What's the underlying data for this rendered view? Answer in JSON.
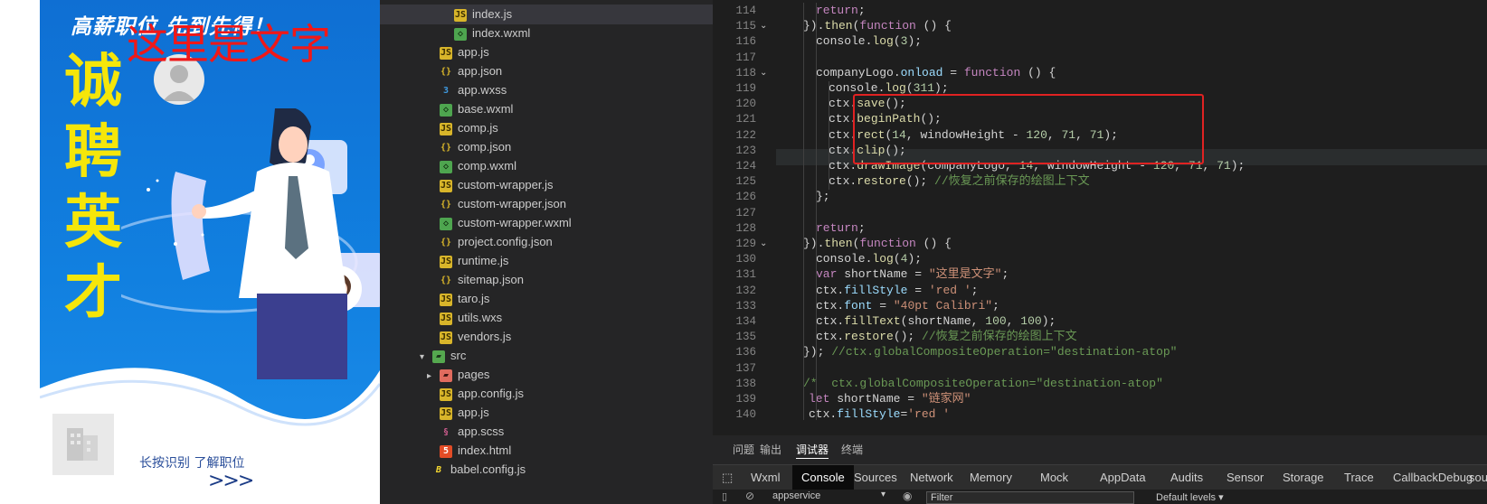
{
  "poster": {
    "headline": "高薪职位    先到先得！",
    "overlay_text": "这里是文字",
    "vertical_title": [
      "诚",
      "聘",
      "英",
      "才"
    ],
    "cta_text": "长按识别 了解职位",
    "cta_arrow": ">>>",
    "colors": {
      "background": "#0f78d8",
      "title": "#f5e60a",
      "overlay": "#f01818"
    }
  },
  "explorer": {
    "items": [
      {
        "label": "index.js",
        "icon": "js",
        "indent": 2,
        "selected": true
      },
      {
        "label": "index.wxml",
        "icon": "wxml",
        "indent": 2
      },
      {
        "label": "app.js",
        "icon": "js",
        "indent": 1
      },
      {
        "label": "app.json",
        "icon": "json",
        "indent": 1
      },
      {
        "label": "app.wxss",
        "icon": "wxss",
        "indent": 1
      },
      {
        "label": "base.wxml",
        "icon": "wxml",
        "indent": 1
      },
      {
        "label": "comp.js",
        "icon": "js",
        "indent": 1
      },
      {
        "label": "comp.json",
        "icon": "json",
        "indent": 1
      },
      {
        "label": "comp.wxml",
        "icon": "wxml",
        "indent": 1
      },
      {
        "label": "custom-wrapper.js",
        "icon": "js",
        "indent": 1
      },
      {
        "label": "custom-wrapper.json",
        "icon": "json",
        "indent": 1
      },
      {
        "label": "custom-wrapper.wxml",
        "icon": "wxml",
        "indent": 1
      },
      {
        "label": "project.config.json",
        "icon": "json",
        "indent": 1
      },
      {
        "label": "runtime.js",
        "icon": "js",
        "indent": 1
      },
      {
        "label": "sitemap.json",
        "icon": "json",
        "indent": 1
      },
      {
        "label": "taro.js",
        "icon": "js",
        "indent": 1
      },
      {
        "label": "utils.wxs",
        "icon": "js",
        "indent": 1
      },
      {
        "label": "vendors.js",
        "icon": "js",
        "indent": 1
      },
      {
        "label": "src",
        "icon": "folder",
        "indent": 0,
        "chevron": "down"
      },
      {
        "label": "pages",
        "icon": "folder-red",
        "indent": 1,
        "chevron": "right"
      },
      {
        "label": "app.config.js",
        "icon": "js",
        "indent": 1
      },
      {
        "label": "app.js",
        "icon": "js",
        "indent": 1
      },
      {
        "label": "app.scss",
        "icon": "scss",
        "indent": 1
      },
      {
        "label": "index.html",
        "icon": "html",
        "indent": 1
      },
      {
        "label": "babel.config.js",
        "icon": "babel",
        "indent": 0
      }
    ]
  },
  "editor": {
    "line_numbers": [
      "114",
      "115",
      "116",
      "117",
      "118",
      "119",
      "120",
      "121",
      "122",
      "123",
      "124",
      "125",
      "126",
      "127",
      "128",
      "129",
      "130",
      "131",
      "132",
      "133",
      "134",
      "135",
      "136",
      "137",
      "138",
      "139",
      "140"
    ],
    "fold_lines": [
      "115",
      "118",
      "129"
    ],
    "lines": [
      "return;",
      "}).then(function () {",
      "console.log(3);",
      "",
      "companyLogo.onload = function () {",
      "console.log(311);",
      "ctx.save();",
      "ctx.beginPath();",
      "ctx.rect(14, windowHeight - 120, 71, 71);",
      "ctx.clip();",
      "ctx.drawImage(companyLogo, 14, windowHeight - 120, 71, 71);",
      "ctx.restore(); //恢复之前保存的绘图上下文",
      "};",
      "",
      "return;",
      "}).then(function () {",
      "console.log(4);",
      "var shortName = \"这里是文字\";",
      "ctx.fillStyle = 'red ';",
      "ctx.font = \"40pt Calibri\";",
      "ctx.fillText(shortName, 100, 100);",
      "ctx.restore(); //恢复之前保存的绘图上下文",
      "}); //ctx.globalCompositeOperation=\"destination-atop\"",
      "",
      "/*  ctx.globalCompositeOperation=\"destination-atop\"",
      "let shortName = \"链家网\"",
      "ctx.fillStyle='red '"
    ]
  },
  "panel": {
    "tabs": [
      "问题",
      "输出",
      "调试器",
      "终端"
    ],
    "active_tab": "调试器",
    "devtools_tabs": [
      "Wxml",
      "Console",
      "Sources",
      "Network",
      "Memory",
      "Mock",
      "AppData",
      "Audits",
      "Sensor",
      "Storage",
      "Trace",
      "CallbackDebug",
      "sour"
    ],
    "active_devtools_tab": "Console",
    "context": "appservice",
    "filter_placeholder": "Filter",
    "levels": "Default levels ▾"
  }
}
